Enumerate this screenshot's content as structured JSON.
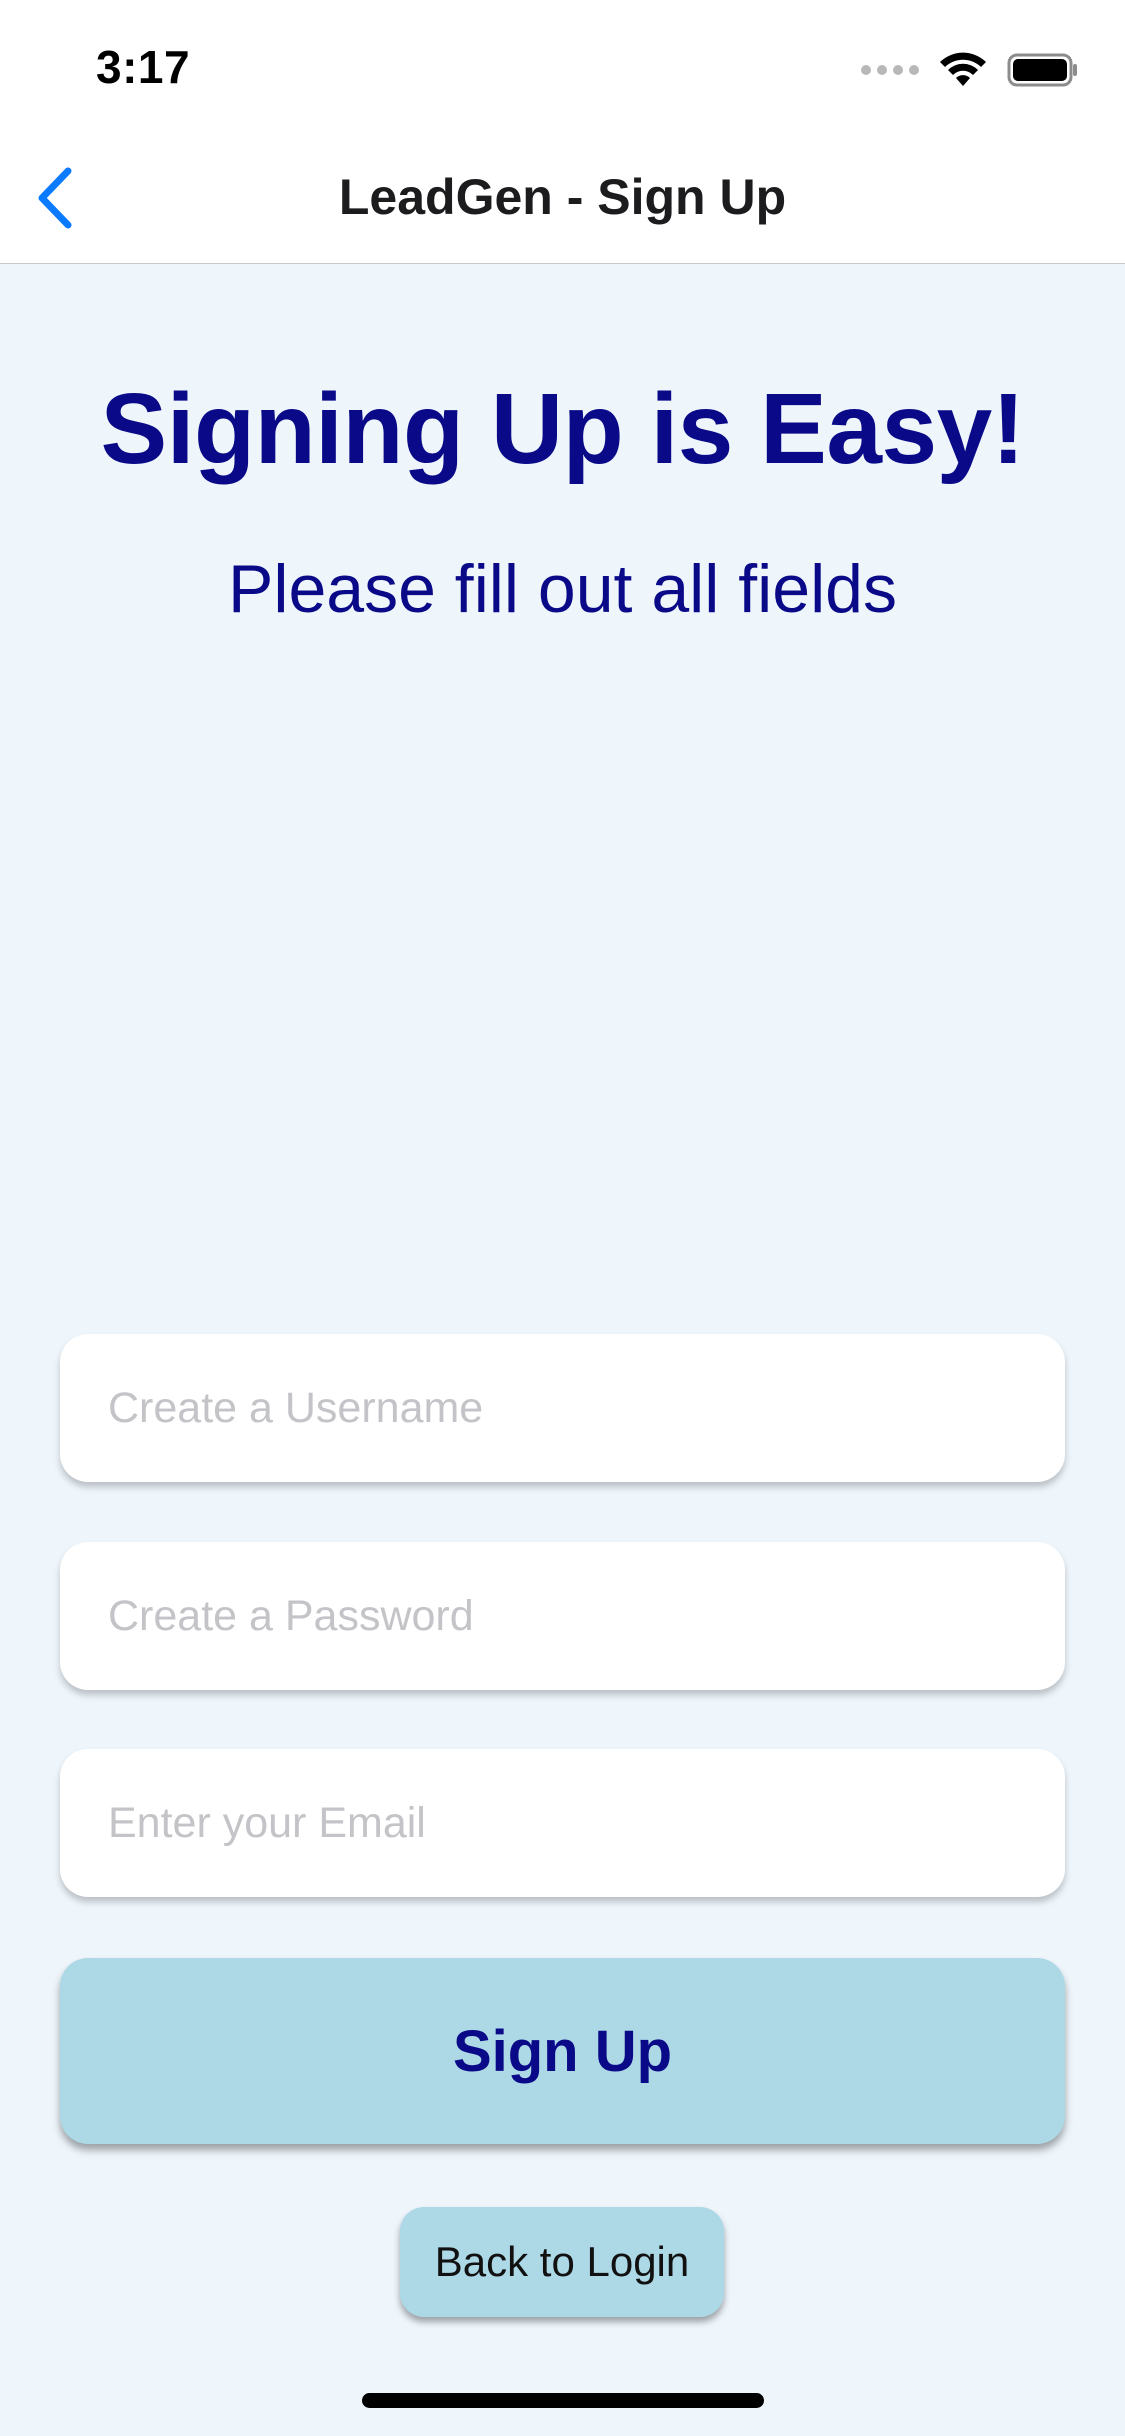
{
  "status_bar": {
    "time": "3:17",
    "icons": [
      "cellular-signal-icon",
      "wifi-icon",
      "battery-icon"
    ]
  },
  "nav": {
    "title": "LeadGen - Sign Up",
    "back_icon": "chevron-left-icon"
  },
  "content": {
    "headline": "Signing Up is Easy!",
    "subheadline": "Please fill out all fields"
  },
  "form": {
    "username": {
      "value": "",
      "placeholder": "Create a Username"
    },
    "password": {
      "value": "",
      "placeholder": "Create a Password"
    },
    "email": {
      "value": "",
      "placeholder": "Enter your Email"
    },
    "signup_label": "Sign Up",
    "back_to_login_label": "Back to Login"
  },
  "colors": {
    "background": "#eef6fc",
    "accent_text": "#0a0a88",
    "button_fill": "#add8e6",
    "nav_back": "#0a7aff"
  }
}
